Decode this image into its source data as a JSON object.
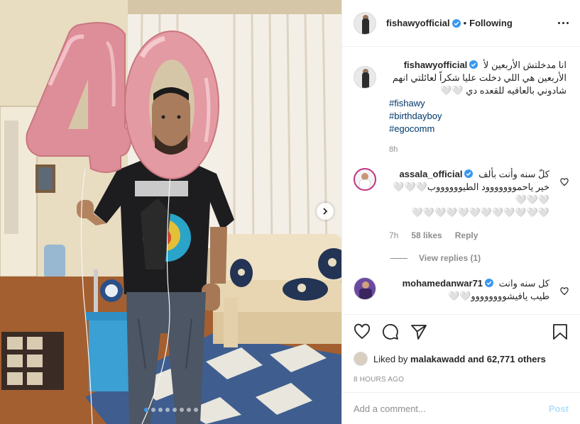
{
  "post": {
    "username": "fishawyofficial",
    "follow_status": "Following",
    "separator": "•",
    "caption_line1": "انا مدخلتش الأربعين لأ",
    "caption_line2": "الأربعين هي اللي دخلت عليا شكراً لعائلتي انهم",
    "caption_line3": "شادوني بالعافيه للقعده دي 🤍🤍",
    "hashtags": [
      "#fishawy",
      "#birthdayboy",
      "#egocomm"
    ],
    "caption_age": "8h",
    "balloon_number": "40"
  },
  "comments": [
    {
      "username": "assala_official",
      "text_line1": "كلّ سنه وأنت بألف",
      "text_line2": "خير ياحمووووووود الطيووووووب🤍🤍🤍🤍🤍🤍",
      "text_line3": "🤍🤍🤍🤍🤍🤍🤍🤍🤍🤍🤍🤍",
      "age": "7h",
      "likes": "58 likes",
      "reply_label": "Reply",
      "view_replies": "View replies (1)"
    },
    {
      "username": "mohamedanwar71",
      "text_line1": "كل سنه وانت",
      "text_line2": "طيب يافيشوووووووو🤍🤍"
    }
  ],
  "liked_by": {
    "prefix": "Liked by",
    "user": "malakawadd",
    "suffix": "and 62,771 others"
  },
  "timestamp": "8 HOURS AGO",
  "add_comment": {
    "placeholder": "Add a comment...",
    "post_label": "Post"
  },
  "carousel": {
    "count": 8,
    "active_index": 0
  },
  "colors": {
    "link": "#00376b",
    "verified": "#3897f0",
    "balloon": "#e7a4a8",
    "post_disabled": "#b2dffc"
  },
  "icons": [
    "heart-icon",
    "comment-icon",
    "share-icon",
    "bookmark-icon",
    "more-icon",
    "verified-icon",
    "chevron-right-icon"
  ]
}
